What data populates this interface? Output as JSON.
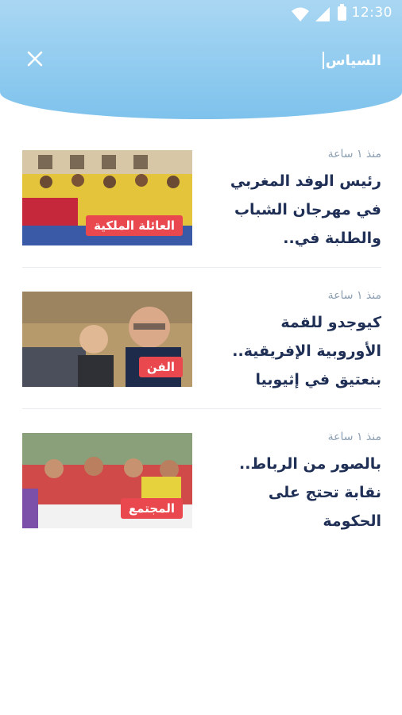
{
  "status_bar": {
    "time": "12:30"
  },
  "header": {
    "search_value": "السياس"
  },
  "articles": [
    {
      "time": "منذ ١ ساعة",
      "title": "رئيس الوفد المغربي في مهرجان الشباب والطلبة في..",
      "category": "العائلة الملكية"
    },
    {
      "time": "منذ ١ ساعة",
      "title": "كيوجدو للقمة الأوروبية الإفريقية.. بنعتيق في إثيوبيا",
      "category": "الفن"
    },
    {
      "time": "منذ ١ ساعة",
      "title": "بالصور من الرباط.. نقابة تحتج على الحكومة",
      "category": "المجتمع"
    }
  ],
  "colors": {
    "header_top": "#a9d7f3",
    "header_bottom": "#7ec2ec",
    "tag": "#e9494e",
    "title": "#1f2f55",
    "meta": "#8da0b3"
  },
  "icons": [
    "wifi-icon",
    "signal-icon",
    "battery-icon",
    "close-icon"
  ]
}
